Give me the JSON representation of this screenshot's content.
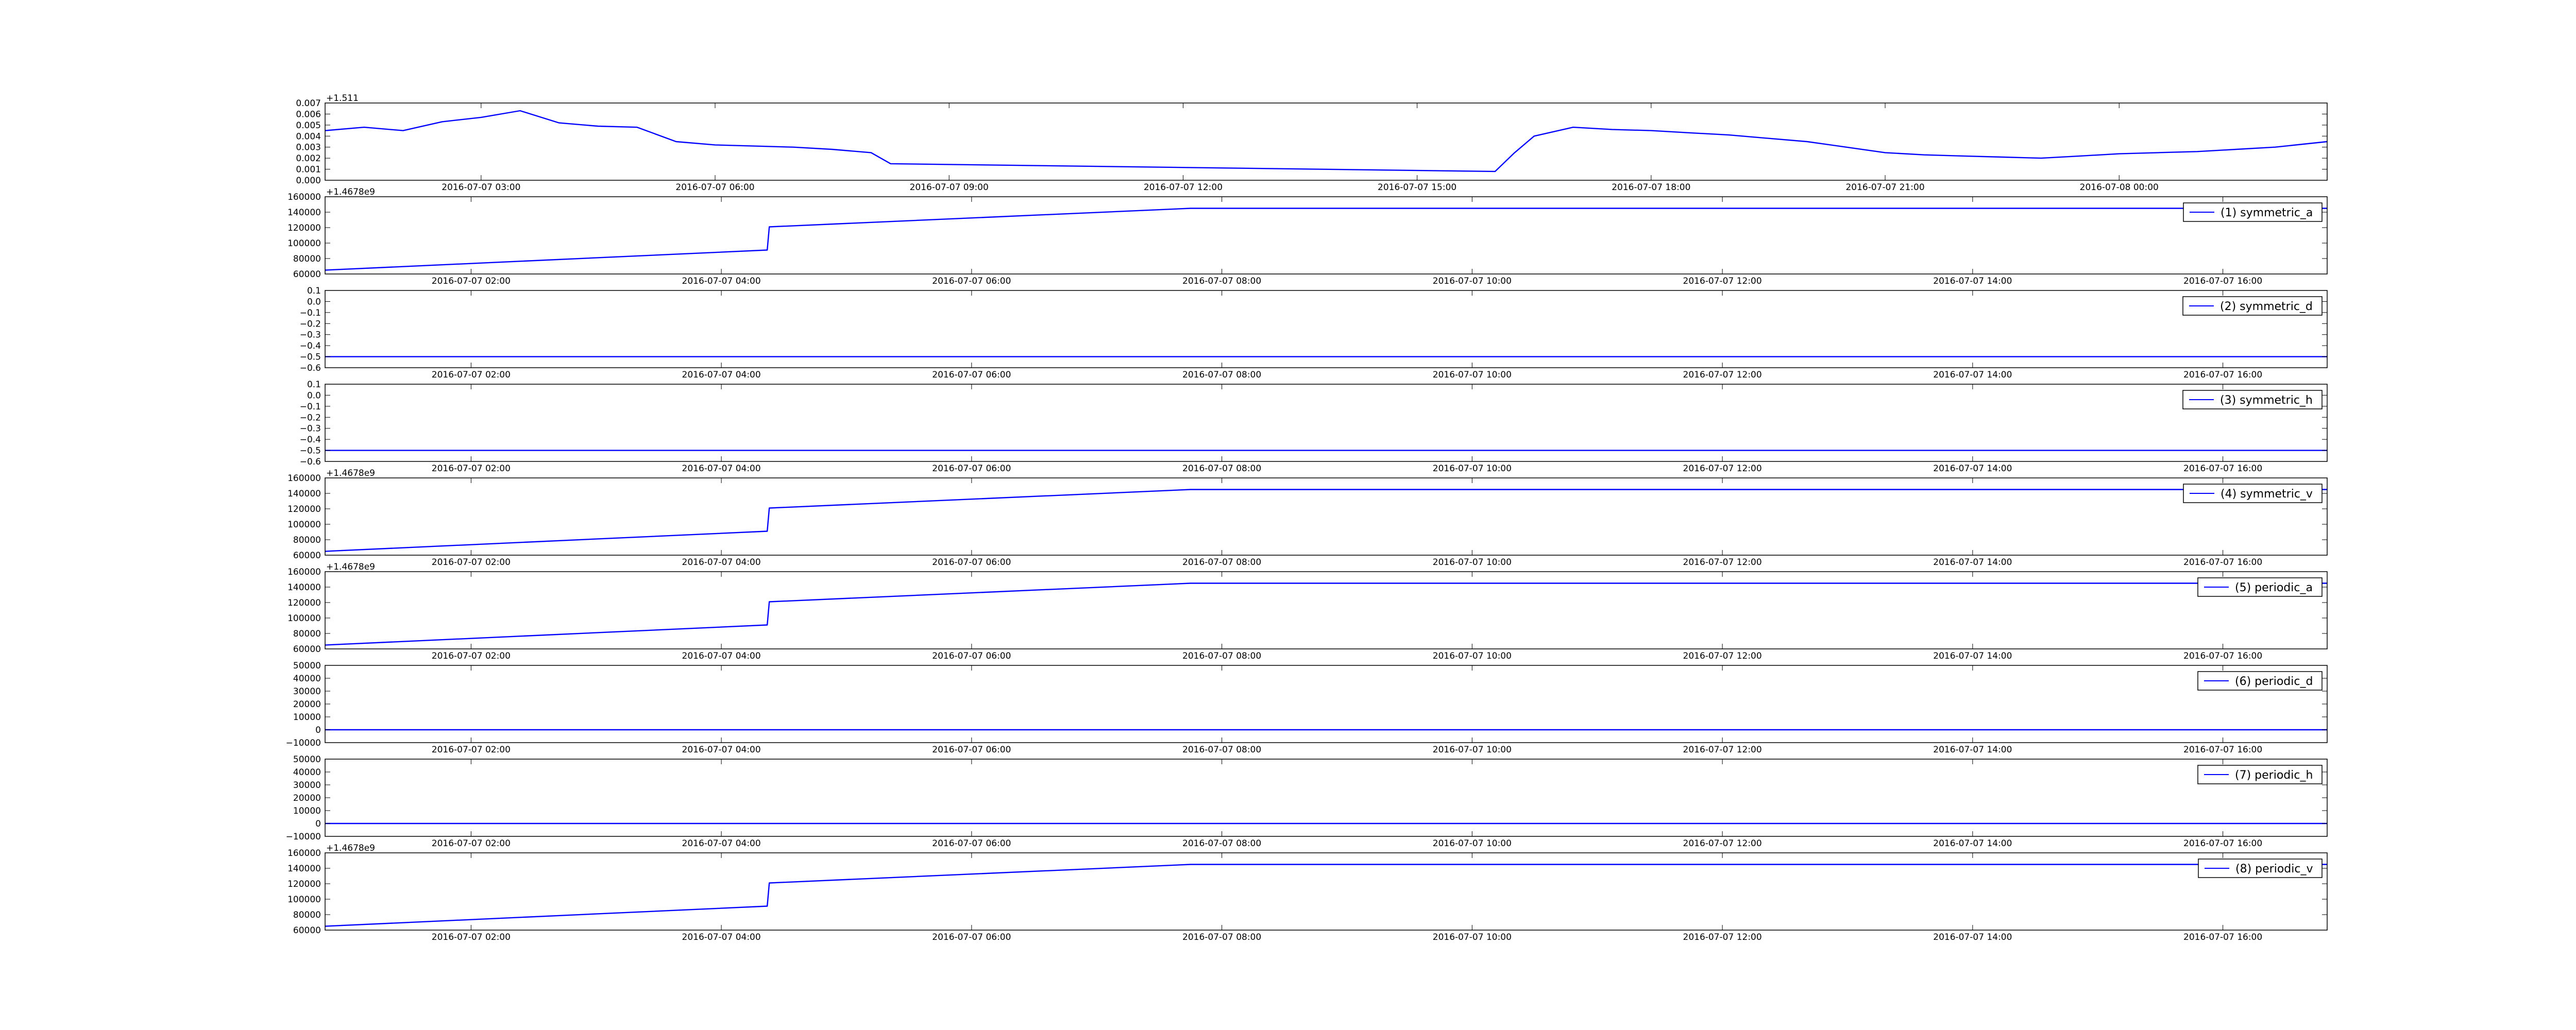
{
  "colors": {
    "series": "#0000ff",
    "axes": "#000000",
    "background": "#ffffff"
  },
  "chart_data": [
    {
      "type": "line",
      "title": "",
      "xlabel": "",
      "ylabel": "",
      "y_offset_text": "+1.511",
      "legend": null,
      "xlim": [
        "2016-07-07 01:00",
        "2016-07-08 02:40"
      ],
      "ylim": [
        0.0,
        0.007
      ],
      "x_ticks": [
        "2016-07-07 03:00",
        "2016-07-07 06:00",
        "2016-07-07 09:00",
        "2016-07-07 12:00",
        "2016-07-07 15:00",
        "2016-07-07 18:00",
        "2016-07-07 21:00",
        "2016-07-08 00:00"
      ],
      "y_ticks": [
        "0.000",
        "0.001",
        "0.002",
        "0.003",
        "0.004",
        "0.005",
        "0.006",
        "0.007"
      ],
      "series": [
        {
          "x": [
            "2016-07-07 01:00",
            "2016-07-07 01:30",
            "2016-07-07 02:00",
            "2016-07-07 02:30",
            "2016-07-07 03:00",
            "2016-07-07 03:30",
            "2016-07-07 04:00",
            "2016-07-07 04:30",
            "2016-07-07 05:00",
            "2016-07-07 05:30",
            "2016-07-07 06:00",
            "2016-07-07 06:30",
            "2016-07-07 07:00",
            "2016-07-07 07:30",
            "2016-07-07 08:00",
            "2016-07-07 08:15",
            "2016-07-07 16:00",
            "2016-07-07 16:15",
            "2016-07-07 16:30",
            "2016-07-07 17:00",
            "2016-07-07 17:30",
            "2016-07-07 18:00",
            "2016-07-07 18:30",
            "2016-07-07 19:00",
            "2016-07-07 19:30",
            "2016-07-07 20:00",
            "2016-07-07 20:30",
            "2016-07-07 21:00",
            "2016-07-07 21:30",
            "2016-07-07 22:00",
            "2016-07-07 22:30",
            "2016-07-07 23:00",
            "2016-07-07 23:30",
            "2016-07-08 00:00",
            "2016-07-08 00:30",
            "2016-07-08 01:00",
            "2016-07-08 01:30",
            "2016-07-08 02:00",
            "2016-07-08 02:40"
          ],
          "values": [
            0.0045,
            0.0048,
            0.0045,
            0.0053,
            0.0057,
            0.0063,
            0.0052,
            0.0049,
            0.0048,
            0.0035,
            0.0032,
            0.0031,
            0.003,
            0.0028,
            0.0025,
            0.0015,
            0.0008,
            0.0025,
            0.004,
            0.0048,
            0.0046,
            0.0045,
            0.0043,
            0.0041,
            0.0038,
            0.0035,
            0.003,
            0.0025,
            0.0023,
            0.0022,
            0.0021,
            0.002,
            0.0022,
            0.0024,
            0.0025,
            0.0026,
            0.0028,
            0.003,
            0.0035
          ]
        }
      ]
    },
    {
      "type": "line",
      "title": "",
      "xlabel": "",
      "ylabel": "",
      "y_offset_text": "+1.4678e9",
      "legend": "(1) symmetric_a",
      "legend_position": "top-right",
      "xlim": [
        "2016-07-07 00:50",
        "2016-07-07 16:50"
      ],
      "ylim": [
        60000,
        160000
      ],
      "x_ticks": [
        "2016-07-07 02:00",
        "2016-07-07 04:00",
        "2016-07-07 06:00",
        "2016-07-07 08:00",
        "2016-07-07 10:00",
        "2016-07-07 12:00",
        "2016-07-07 14:00",
        "2016-07-07 16:00"
      ],
      "y_ticks": [
        "60000",
        "80000",
        "100000",
        "120000",
        "140000",
        "160000"
      ],
      "series": [
        {
          "name": "(1) symmetric_a",
          "x": [
            "2016-07-07 00:50",
            "2016-07-07 04:22",
            "2016-07-07 04:23",
            "2016-07-07 07:45",
            "2016-07-07 16:50"
          ],
          "values": [
            65000,
            91000,
            121000,
            145000,
            145000
          ]
        }
      ]
    },
    {
      "type": "line",
      "title": "",
      "xlabel": "",
      "ylabel": "",
      "y_offset_text": "",
      "legend": "(2) symmetric_d",
      "legend_position": "top-right",
      "xlim": [
        "2016-07-07 00:50",
        "2016-07-07 16:50"
      ],
      "ylim": [
        -0.6,
        0.1
      ],
      "x_ticks": [
        "2016-07-07 02:00",
        "2016-07-07 04:00",
        "2016-07-07 06:00",
        "2016-07-07 08:00",
        "2016-07-07 10:00",
        "2016-07-07 12:00",
        "2016-07-07 14:00",
        "2016-07-07 16:00"
      ],
      "y_ticks": [
        "−0.6",
        "−0.5",
        "−0.4",
        "−0.3",
        "−0.2",
        "−0.1",
        "0.0",
        "0.1"
      ],
      "series": [
        {
          "name": "(2) symmetric_d",
          "x": [
            "2016-07-07 00:50",
            "2016-07-07 16:50"
          ],
          "values": [
            -0.5,
            -0.5
          ]
        }
      ]
    },
    {
      "type": "line",
      "title": "",
      "xlabel": "",
      "ylabel": "",
      "y_offset_text": "",
      "legend": "(3) symmetric_h",
      "legend_position": "top-right",
      "xlim": [
        "2016-07-07 00:50",
        "2016-07-07 16:50"
      ],
      "ylim": [
        -0.6,
        0.1
      ],
      "x_ticks": [
        "2016-07-07 02:00",
        "2016-07-07 04:00",
        "2016-07-07 06:00",
        "2016-07-07 08:00",
        "2016-07-07 10:00",
        "2016-07-07 12:00",
        "2016-07-07 14:00",
        "2016-07-07 16:00"
      ],
      "y_ticks": [
        "−0.6",
        "−0.5",
        "−0.4",
        "−0.3",
        "−0.2",
        "−0.1",
        "0.0",
        "0.1"
      ],
      "series": [
        {
          "name": "(3) symmetric_h",
          "x": [
            "2016-07-07 00:50",
            "2016-07-07 16:50"
          ],
          "values": [
            -0.5,
            -0.5
          ]
        }
      ]
    },
    {
      "type": "line",
      "title": "",
      "xlabel": "",
      "ylabel": "",
      "y_offset_text": "+1.4678e9",
      "legend": "(4) symmetric_v",
      "legend_position": "top-right",
      "xlim": [
        "2016-07-07 00:50",
        "2016-07-07 16:50"
      ],
      "ylim": [
        60000,
        160000
      ],
      "x_ticks": [
        "2016-07-07 02:00",
        "2016-07-07 04:00",
        "2016-07-07 06:00",
        "2016-07-07 08:00",
        "2016-07-07 10:00",
        "2016-07-07 12:00",
        "2016-07-07 14:00",
        "2016-07-07 16:00"
      ],
      "y_ticks": [
        "60000",
        "80000",
        "100000",
        "120000",
        "140000",
        "160000"
      ],
      "series": [
        {
          "name": "(4) symmetric_v",
          "x": [
            "2016-07-07 00:50",
            "2016-07-07 04:22",
            "2016-07-07 04:23",
            "2016-07-07 07:45",
            "2016-07-07 16:50"
          ],
          "values": [
            65000,
            91000,
            121000,
            145000,
            145000
          ]
        }
      ]
    },
    {
      "type": "line",
      "title": "",
      "xlabel": "",
      "ylabel": "",
      "y_offset_text": "+1.4678e9",
      "legend": "(5) periodic_a",
      "legend_position": "top-right",
      "xlim": [
        "2016-07-07 00:50",
        "2016-07-07 16:50"
      ],
      "ylim": [
        60000,
        160000
      ],
      "x_ticks": [
        "2016-07-07 02:00",
        "2016-07-07 04:00",
        "2016-07-07 06:00",
        "2016-07-07 08:00",
        "2016-07-07 10:00",
        "2016-07-07 12:00",
        "2016-07-07 14:00",
        "2016-07-07 16:00"
      ],
      "y_ticks": [
        "60000",
        "80000",
        "100000",
        "120000",
        "140000",
        "160000"
      ],
      "series": [
        {
          "name": "(5) periodic_a",
          "x": [
            "2016-07-07 00:50",
            "2016-07-07 04:22",
            "2016-07-07 04:23",
            "2016-07-07 07:45",
            "2016-07-07 16:50"
          ],
          "values": [
            65000,
            91000,
            121000,
            145000,
            145000
          ]
        }
      ]
    },
    {
      "type": "line",
      "title": "",
      "xlabel": "",
      "ylabel": "",
      "y_offset_text": "",
      "legend": "(6) periodic_d",
      "legend_position": "top-right",
      "xlim": [
        "2016-07-07 00:50",
        "2016-07-07 16:50"
      ],
      "ylim": [
        -10000,
        50000
      ],
      "x_ticks": [
        "2016-07-07 02:00",
        "2016-07-07 04:00",
        "2016-07-07 06:00",
        "2016-07-07 08:00",
        "2016-07-07 10:00",
        "2016-07-07 12:00",
        "2016-07-07 14:00",
        "2016-07-07 16:00"
      ],
      "y_ticks": [
        "−10000",
        "0",
        "10000",
        "20000",
        "30000",
        "40000",
        "50000"
      ],
      "series": [
        {
          "name": "(6) periodic_d",
          "x": [
            "2016-07-07 00:50",
            "2016-07-07 16:50"
          ],
          "values": [
            0,
            0
          ]
        }
      ]
    },
    {
      "type": "line",
      "title": "",
      "xlabel": "",
      "ylabel": "",
      "y_offset_text": "",
      "legend": "(7) periodic_h",
      "legend_position": "top-right",
      "xlim": [
        "2016-07-07 00:50",
        "2016-07-07 16:50"
      ],
      "ylim": [
        -10000,
        50000
      ],
      "x_ticks": [
        "2016-07-07 02:00",
        "2016-07-07 04:00",
        "2016-07-07 06:00",
        "2016-07-07 08:00",
        "2016-07-07 10:00",
        "2016-07-07 12:00",
        "2016-07-07 14:00",
        "2016-07-07 16:00"
      ],
      "y_ticks": [
        "−10000",
        "0",
        "10000",
        "20000",
        "30000",
        "40000",
        "50000"
      ],
      "series": [
        {
          "name": "(7) periodic_h",
          "x": [
            "2016-07-07 00:50",
            "2016-07-07 16:50"
          ],
          "values": [
            0,
            0
          ]
        }
      ]
    },
    {
      "type": "line",
      "title": "",
      "xlabel": "",
      "ylabel": "",
      "y_offset_text": "+1.4678e9",
      "legend": "(8) periodic_v",
      "legend_position": "top-right",
      "xlim": [
        "2016-07-07 00:50",
        "2016-07-07 16:50"
      ],
      "ylim": [
        60000,
        160000
      ],
      "x_ticks": [
        "2016-07-07 02:00",
        "2016-07-07 04:00",
        "2016-07-07 06:00",
        "2016-07-07 08:00",
        "2016-07-07 10:00",
        "2016-07-07 12:00",
        "2016-07-07 14:00",
        "2016-07-07 16:00"
      ],
      "y_ticks": [
        "60000",
        "80000",
        "100000",
        "120000",
        "140000",
        "160000"
      ],
      "series": [
        {
          "name": "(8) periodic_v",
          "x": [
            "2016-07-07 00:50",
            "2016-07-07 04:22",
            "2016-07-07 04:23",
            "2016-07-07 07:45",
            "2016-07-07 16:50"
          ],
          "values": [
            65000,
            91000,
            121000,
            145000,
            145000
          ]
        }
      ]
    }
  ]
}
